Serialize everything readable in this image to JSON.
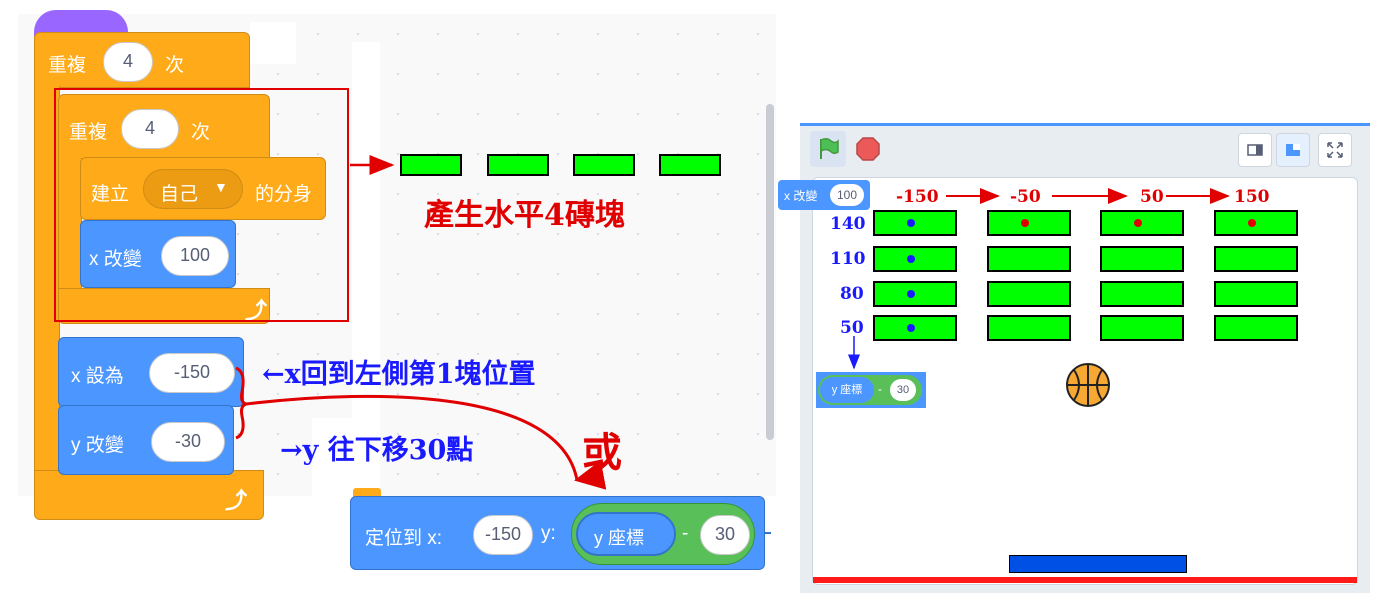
{
  "code": {
    "outer_repeat": {
      "label": "重複",
      "count": "4",
      "suffix": "次"
    },
    "inner_repeat": {
      "label": "重複",
      "count": "4",
      "suffix": "次"
    },
    "create_clone": {
      "label": "建立",
      "target": "自己",
      "suffix": "的分身"
    },
    "change_x": {
      "label": "x 改變",
      "value": "100"
    },
    "set_x": {
      "label": "x 設為",
      "value": "-150"
    },
    "change_y": {
      "label": "y 改變",
      "value": "-30"
    },
    "goto": {
      "label": "定位到 x:",
      "x": "-150",
      "y_label": "y:",
      "reporter": "y 座標",
      "op": "-",
      "op_value": "30"
    }
  },
  "annotations": {
    "bricks_note": "產生水平4磚塊",
    "x_note": "←x回到左側第1塊位置",
    "y_note": "→y 往下移30點",
    "or": "或"
  },
  "stage": {
    "x_values": [
      "-150",
      "-50",
      "50",
      "150"
    ],
    "y_values": [
      "140",
      "110",
      "80",
      "50"
    ],
    "mini_change_x": {
      "label": "x 改變",
      "value": "100"
    },
    "mini_ycoord": {
      "label": "y 座標",
      "op": "-",
      "value": "30"
    }
  },
  "colors": {
    "block_orange": "#ffab19",
    "block_blue": "#4c97ff",
    "operator_green": "#59c059",
    "brick": "#00ff00",
    "annotation_red": "#e00000",
    "annotation_blue": "#1a1aff"
  }
}
